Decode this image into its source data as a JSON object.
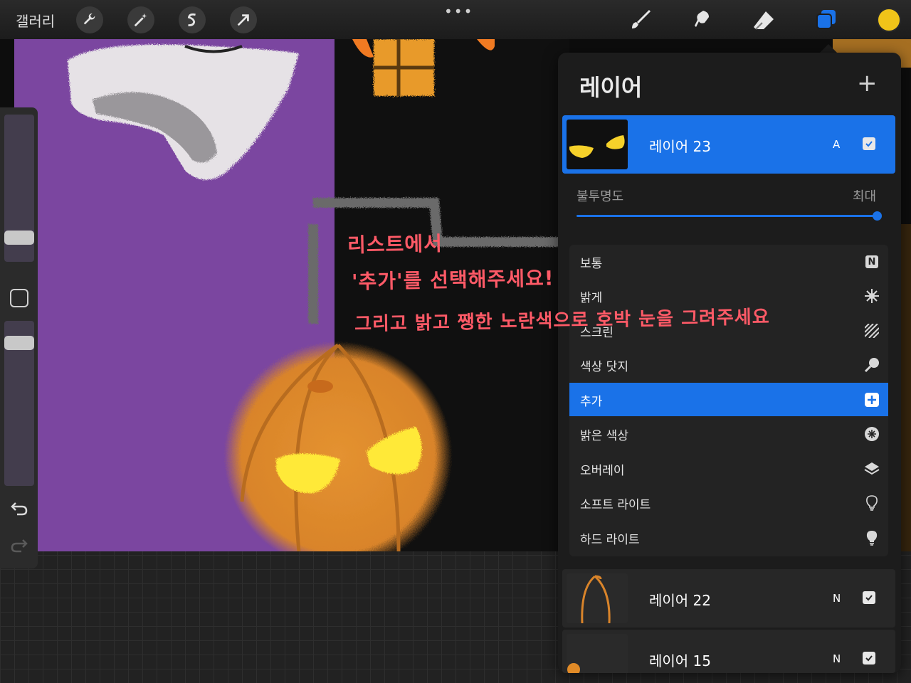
{
  "topbar": {
    "gallery_label": "갤러리",
    "menu_dots": "•••",
    "tools_left": [
      "wrench-icon",
      "magic-wand-icon",
      "selection-icon",
      "transform-arrow-icon"
    ],
    "tools_right": [
      "brush-icon",
      "smudge-icon",
      "eraser-icon",
      "layers-icon"
    ],
    "current_color": "#f0c419"
  },
  "sidebar": {
    "brush_size_level": 0.35,
    "opacity_level": 0.9
  },
  "layers_panel": {
    "title": "레이어",
    "add_symbol": "+",
    "active_layer": {
      "name": "레이어 23",
      "blend": "A",
      "visible": true
    },
    "opacity": {
      "label": "불투명도",
      "value_label": "최대",
      "value": 1.0
    },
    "blend_modes": [
      {
        "label": "보통",
        "icon": "normal-N-icon",
        "glyph": "N",
        "selected": false
      },
      {
        "label": "밝게",
        "icon": "sunburst-icon",
        "selected": false
      },
      {
        "label": "스크린",
        "icon": "stripes-icon",
        "selected": false
      },
      {
        "label": "색상 닷지",
        "icon": "dodge-icon",
        "selected": false
      },
      {
        "label": "추가",
        "icon": "plus-square-icon",
        "selected": true
      },
      {
        "label": "밝은 색상",
        "icon": "light-color-icon",
        "selected": false
      },
      {
        "label": "오버레이",
        "icon": "stack-icon",
        "selected": false
      },
      {
        "label": "소프트 라이트",
        "icon": "bulb-icon",
        "selected": false
      },
      {
        "label": "하드 라이트",
        "icon": "bulb-half-icon",
        "selected": false
      }
    ],
    "other_layers": [
      {
        "name": "레이어 22",
        "blend": "N",
        "visible": true
      },
      {
        "name": "레이어 15",
        "blend": "N",
        "visible": true
      }
    ]
  },
  "annotation": {
    "line1": "리스트에서",
    "line2": "'추가'를 선택해주세요!",
    "line3": "그리고 밝고 쨍한 노란색으로 호박 눈을 그려주세요"
  },
  "colors": {
    "accent": "#1a72e8",
    "annotation": "#ff5a67",
    "canvas_purple": "#7b46a0",
    "pumpkin": "#e08a27",
    "eye_yellow": "#ffe937"
  }
}
